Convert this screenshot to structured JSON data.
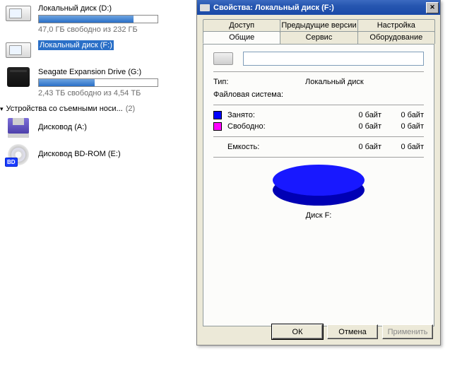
{
  "explorer": {
    "drives_group": {
      "items": [
        {
          "label": "Локальный диск (D:)",
          "sub": "47,0 ГБ свободно из 232 ГБ",
          "fill_pct": 80,
          "show_bar": true
        },
        {
          "label": "Локальный диск (F:)",
          "sub": "",
          "fill_pct": 0,
          "show_bar": false,
          "selected": true
        },
        {
          "label": "Seagate Expansion Drive (G:)",
          "sub": "2,43 ТБ свободно из 4,54 ТБ",
          "fill_pct": 47,
          "show_bar": true,
          "external": true
        }
      ]
    },
    "removable_group": {
      "header": "Устройства со съемными носи...",
      "count": "(2)",
      "items": [
        {
          "label": "Дисковод (A:)"
        },
        {
          "label": "Дисковод BD-ROM (E:)",
          "bd_badge": "BD"
        }
      ]
    }
  },
  "dialog": {
    "title": "Свойства: Локальный диск (F:)",
    "tabs_back": [
      "Доступ",
      "Предыдущие версии",
      "Настройка"
    ],
    "tabs_front": [
      "Общие",
      "Сервис",
      "Оборудование"
    ],
    "active_tab": "Общие",
    "name_value": "",
    "type_label": "Тип:",
    "type_value": "Локальный диск",
    "fs_label": "Файловая система:",
    "fs_value": "",
    "used_label": "Занято:",
    "free_label": "Свободно:",
    "capacity_label": "Емкость:",
    "zero_bytes": "0 байт",
    "pie_caption": "Диск F:",
    "buttons": {
      "ok": "ОК",
      "cancel": "Отмена",
      "apply": "Применить"
    }
  },
  "chart_data": {
    "type": "pie",
    "title": "Диск F:",
    "series": [
      {
        "name": "Занято",
        "value": 0,
        "unit": "байт",
        "display": "0 байт",
        "color": "#0000ff"
      },
      {
        "name": "Свободно",
        "value": 0,
        "unit": "байт",
        "display": "0 байт",
        "color": "#ff00ff"
      }
    ],
    "total": {
      "name": "Емкость",
      "value": 0,
      "unit": "байт",
      "display": "0 байт"
    }
  }
}
